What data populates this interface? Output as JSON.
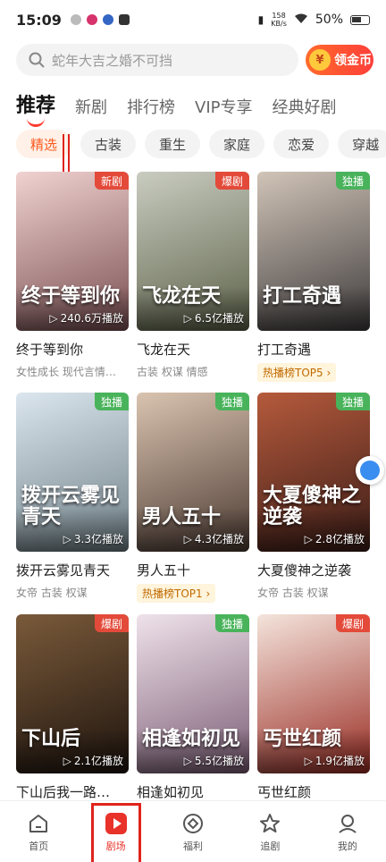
{
  "status": {
    "time": "15:09",
    "net_speed_value": "158",
    "net_speed_unit": "KB/s",
    "battery": "50%"
  },
  "search": {
    "placeholder": "蛇年大吉之婚不可挡",
    "coin_button": "领金币",
    "coin_symbol": "¥"
  },
  "tabs": [
    {
      "label": "推荐",
      "active": true
    },
    {
      "label": "新剧"
    },
    {
      "label": "排行榜"
    },
    {
      "label": "VIP专享"
    },
    {
      "label": "经典好剧"
    }
  ],
  "chips": [
    {
      "label": "精选",
      "active": true
    },
    {
      "label": "古装"
    },
    {
      "label": "重生"
    },
    {
      "label": "家庭"
    },
    {
      "label": "恋爱"
    },
    {
      "label": "穿越"
    }
  ],
  "dramas": [
    {
      "title": "终于等到你",
      "badge": "新剧",
      "plays": "240.6万播放",
      "tags": "女性成长 现代言情…",
      "poster_text": "终于等到你",
      "colors": [
        "#f0d2d0",
        "#7a4f52"
      ]
    },
    {
      "title": "飞龙在天",
      "badge": "爆剧",
      "plays": "6.5亿播放",
      "tags": "古装 权谋 情感",
      "poster_text": "飞龙在天",
      "colors": [
        "#c9ccc0",
        "#5d6249"
      ]
    },
    {
      "title": "打工奇遇",
      "badge": "独播",
      "plays": "",
      "rank": "热播榜TOP5",
      "poster_text": "打工奇遇",
      "colors": [
        "#d1c4b8",
        "#3e3b3c"
      ]
    },
    {
      "title": "拨开云雾见青天",
      "badge": "独播",
      "plays": "3.3亿播放",
      "tags": "女帝 古装 权谋",
      "poster_text": "拨开云雾见青天",
      "colors": [
        "#dbe6ee",
        "#6f7f86"
      ]
    },
    {
      "title": "男人五十",
      "badge": "独播",
      "plays": "4.3亿播放",
      "rank": "热播榜TOP1",
      "poster_text": "男人五十",
      "colors": [
        "#d9c3b0",
        "#4d3b33"
      ]
    },
    {
      "title": "大夏傻神之逆袭",
      "badge": "独播",
      "plays": "2.8亿播放",
      "tags": "女帝 古装 权谋",
      "poster_text": "大夏傻神之逆袭",
      "colors": [
        "#b55a3c",
        "#3a1c17"
      ]
    },
    {
      "title": "下山后我一路…",
      "badge": "爆剧",
      "plays": "2.1亿播放",
      "tags": "",
      "poster_text": "下山后",
      "colors": [
        "#7a5a3a",
        "#1e140e"
      ]
    },
    {
      "title": "相逢如初见",
      "badge": "独播",
      "plays": "5.5亿播放",
      "tags": "",
      "poster_text": "相逢如初见",
      "colors": [
        "#efe2ea",
        "#7b5d75"
      ]
    },
    {
      "title": "丐世红颜",
      "badge": "爆剧",
      "plays": "1.9亿播放",
      "tags": "",
      "poster_text": "丐世红颜",
      "colors": [
        "#f4e4dc",
        "#9a2d24"
      ]
    }
  ],
  "nav": [
    {
      "label": "首页",
      "icon": "home-icon"
    },
    {
      "label": "剧场",
      "icon": "play-icon",
      "active": true
    },
    {
      "label": "福利",
      "icon": "gift-icon"
    },
    {
      "label": "追剧",
      "icon": "star-icon"
    },
    {
      "label": "我的",
      "icon": "user-icon"
    }
  ],
  "colors": {
    "accent": "#ff3b30",
    "chip_active": "#ff5a1f",
    "badge_red": "#e34a3a",
    "badge_green": "#49b35b"
  }
}
